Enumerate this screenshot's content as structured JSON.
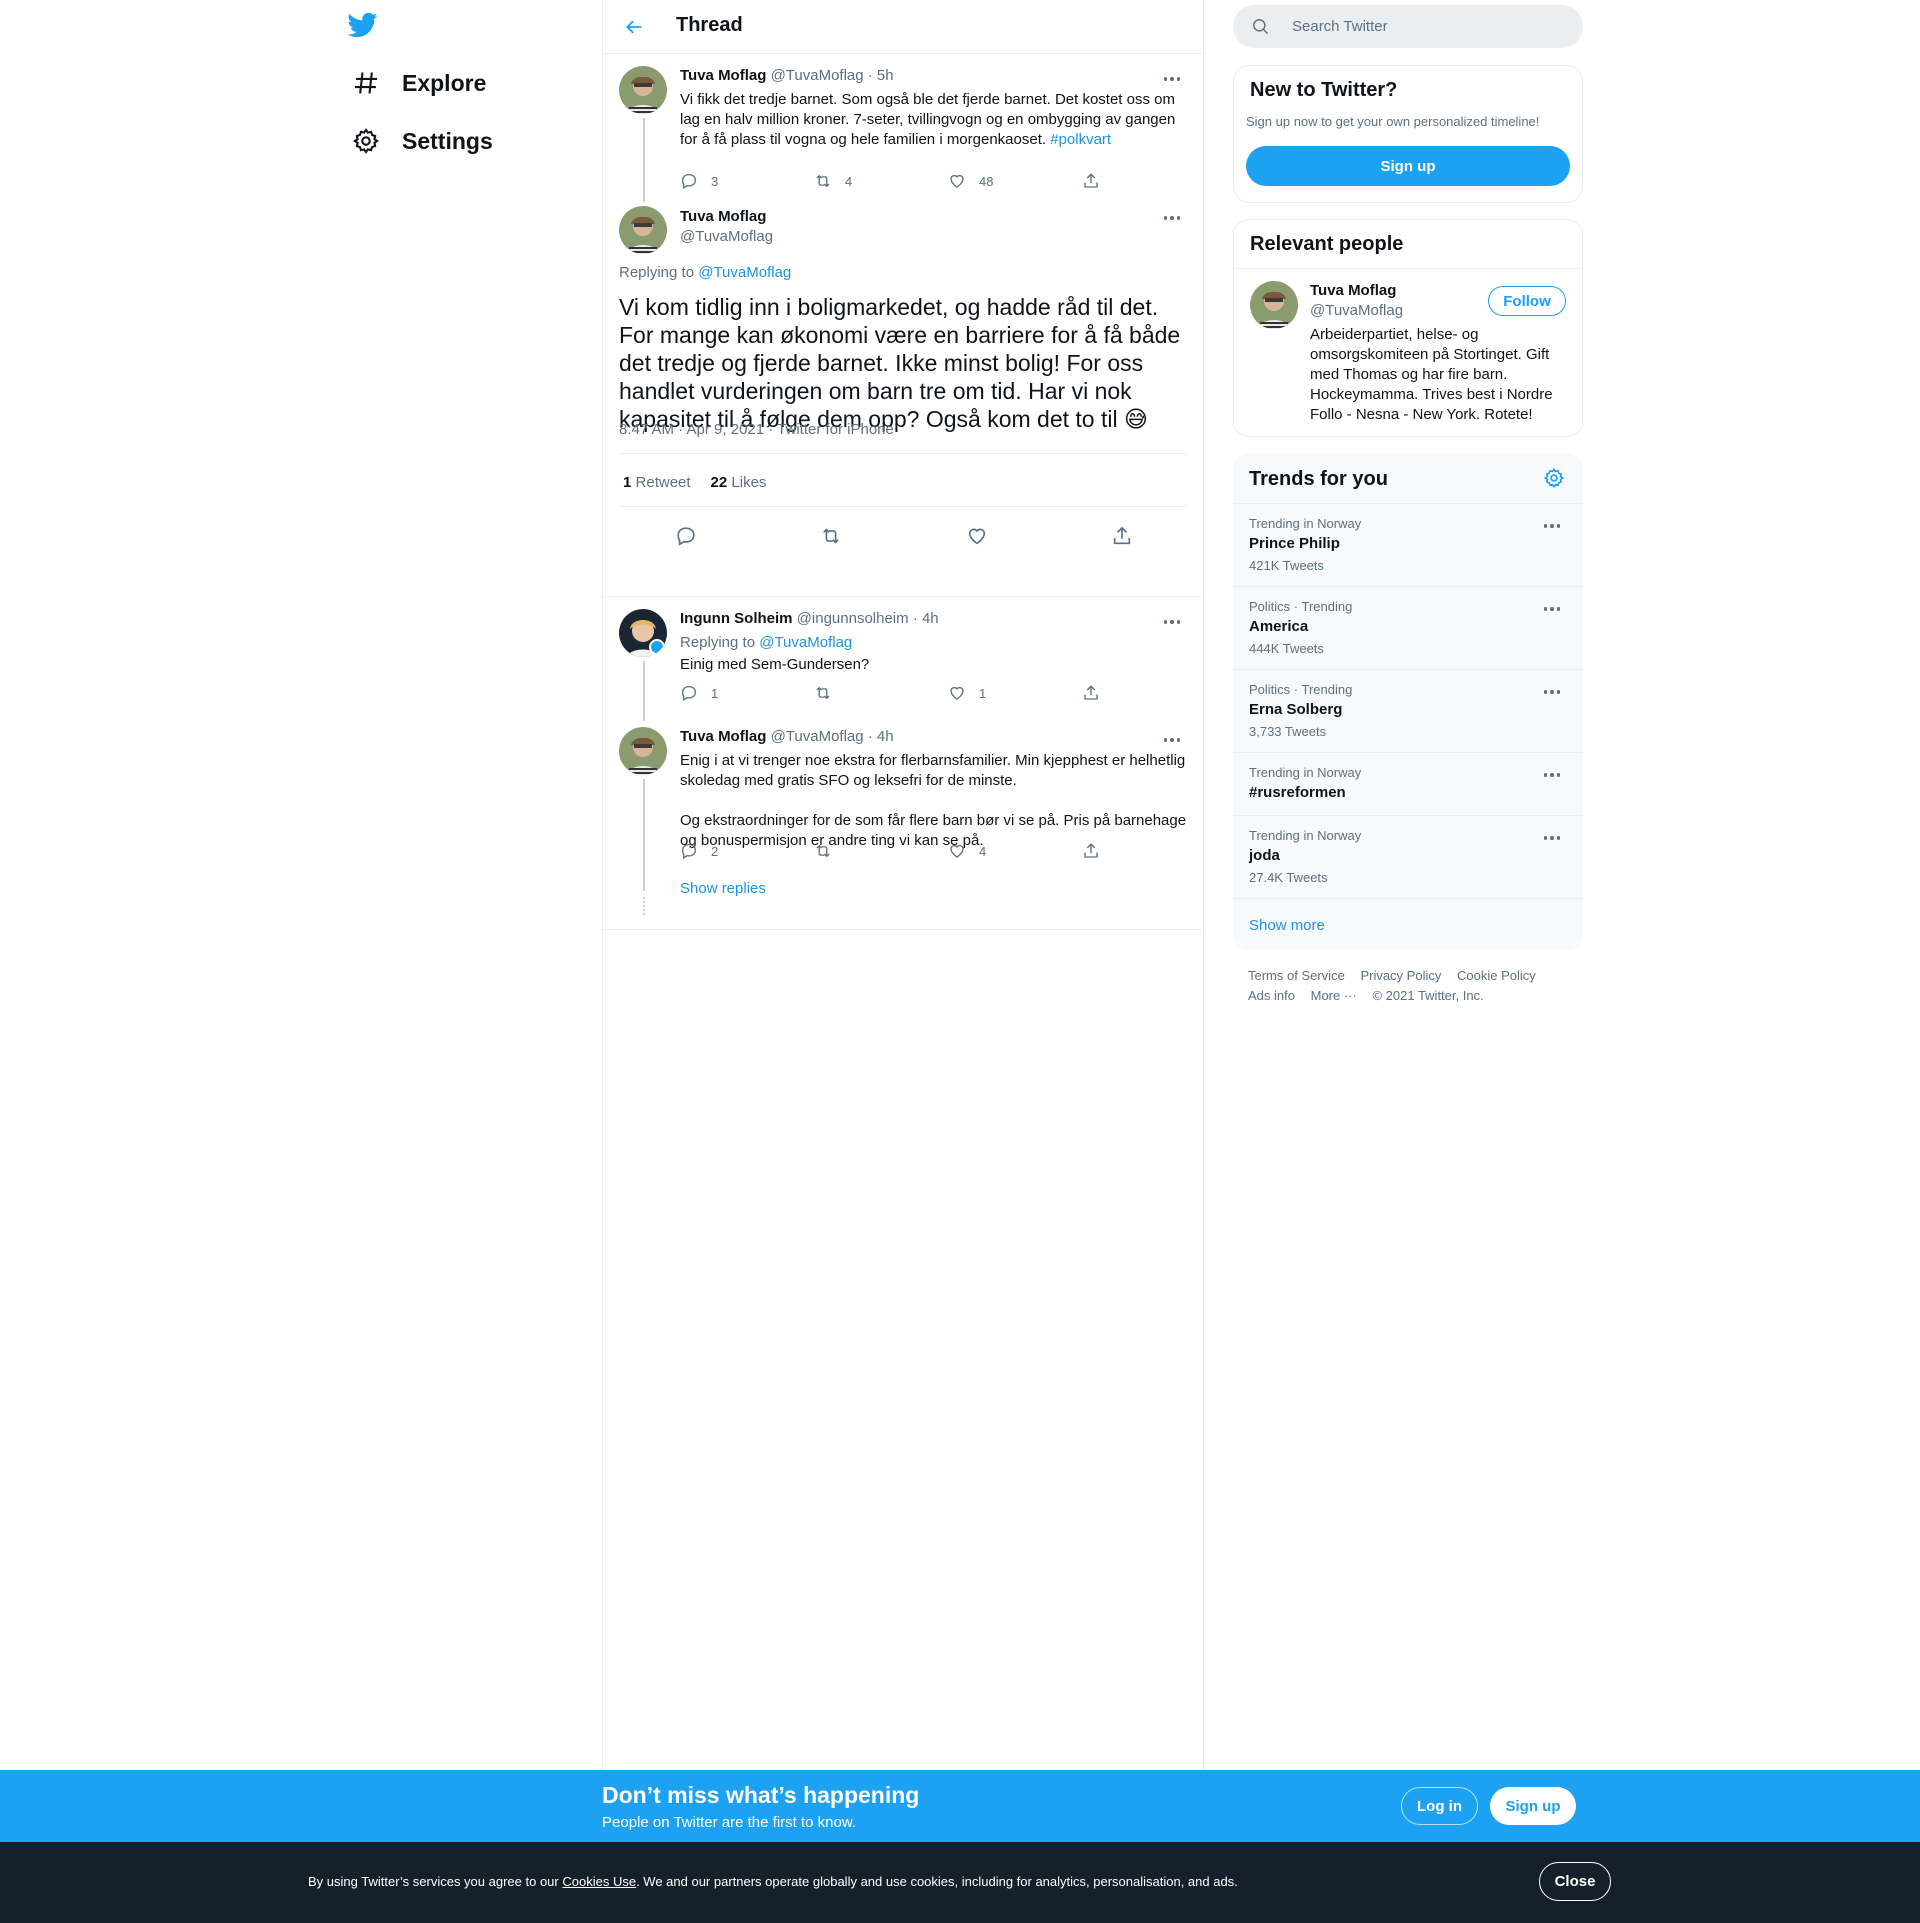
{
  "nav": {
    "explore_label": "Explore",
    "settings_label": "Settings"
  },
  "header": {
    "title": "Thread"
  },
  "tweets": [
    {
      "name": "Tuva Moflag",
      "meta": "@TuvaMoflag · 5h",
      "text": "Vi fikk det tredje barnet. Som også ble det fjerde barnet. Det kostet oss om lag en halv million kroner. 7-seter, tvillingvogn og en ombygging av gangen for å få plass til vogna og hele familien i morgenkaoset. ",
      "hashtag": "#polkvart",
      "replies": "3",
      "retweets": "4",
      "likes": "48"
    }
  ],
  "main_tweet": {
    "name": "Tuva Moflag",
    "handle": "@TuvaMoflag",
    "replying_prefix": "Replying to ",
    "replying_to": "@TuvaMoflag",
    "text": "Vi kom tidlig inn i boligmarkedet, og hadde råd til det. For mange kan økonomi være en barriere for å få både det tredje og fjerde barnet. Ikke minst bolig! For oss handlet vurderingen om barn tre om tid. Har vi nok kapasitet til å følge dem opp? Også kom det to til",
    "emoji": "😅",
    "timestamp": "8:47 AM · Apr 9, 2021 · Twitter for iPhone",
    "retweet_count": "1",
    "retweet_label": "Retweet",
    "like_count": "22",
    "like_label": "Likes"
  },
  "replies": [
    {
      "name": "Ingunn Solheim",
      "meta": "@ingunnsolheim · 4h",
      "replying_prefix": "Replying to ",
      "replying_to": "@TuvaMoflag",
      "text": "Einig med Sem-Gundersen?",
      "replies": "1",
      "retweets": "",
      "likes": "1"
    },
    {
      "name": "Tuva Moflag",
      "meta": "@TuvaMoflag · 4h",
      "text": "Enig i at vi trenger noe ekstra for flerbarnsfamilier. Min kjepphest er helhetlig skoledag med gratis SFO og leksefri for de minste.\n\nOg ekstraordninger for de som får flere barn bør vi se på. Pris på barnehage og bonuspermisjon er andre ting vi kan se på.",
      "replies": "2",
      "retweets": "",
      "likes": "4"
    }
  ],
  "show_replies_label": "Show replies",
  "search": {
    "placeholder": "Search Twitter"
  },
  "new_to_twitter": {
    "title": "New to Twitter?",
    "subtitle": "Sign up now to get your own personalized timeline!",
    "button": "Sign up"
  },
  "relevant_people": {
    "title": "Relevant people",
    "name": "Tuva Moflag",
    "handle": "@TuvaMoflag",
    "follow_label": "Follow",
    "bio": "Arbeiderpartiet, helse- og omsorgskomiteen på Stortinget. Gift med Thomas og har fire barn. Hockeymamma. Trives best i Nordre Follo - Nesna - New York. Rotete!"
  },
  "trends": {
    "title": "Trends for you",
    "items": [
      {
        "category": "Trending in Norway",
        "name": "Prince Philip",
        "count": "421K Tweets"
      },
      {
        "category": "Politics · Trending",
        "name": "America",
        "count": "444K Tweets"
      },
      {
        "category": "Politics · Trending",
        "name": "Erna Solberg",
        "count": "3,733 Tweets"
      },
      {
        "category": "Trending in Norway",
        "name": "#rusreformen",
        "count": ""
      },
      {
        "category": "Trending in Norway",
        "name": "joda",
        "count": "27.4K Tweets"
      }
    ],
    "show_more": "Show more"
  },
  "footer": {
    "terms": "Terms of Service",
    "privacy": "Privacy Policy",
    "cookie": "Cookie Policy",
    "ads": "Ads info",
    "more": "More ···",
    "copyright": "© 2021 Twitter, Inc."
  },
  "promo": {
    "title": "Don’t miss what’s happening",
    "subtitle": "People on Twitter are the first to know.",
    "login": "Log in",
    "signup": "Sign up"
  },
  "cookie_bar": {
    "prefix": "By using Twitter’s services you agree to our ",
    "link": "Cookies Use",
    "suffix": ". We and our partners operate globally and use cookies, including for analytics, personalisation, and ads.",
    "close": "Close"
  },
  "colors": {
    "accent": "#1da1f2",
    "link": "#1b95e0",
    "secondary_text": "#5b7083",
    "cookie_bg": "#15202b"
  }
}
